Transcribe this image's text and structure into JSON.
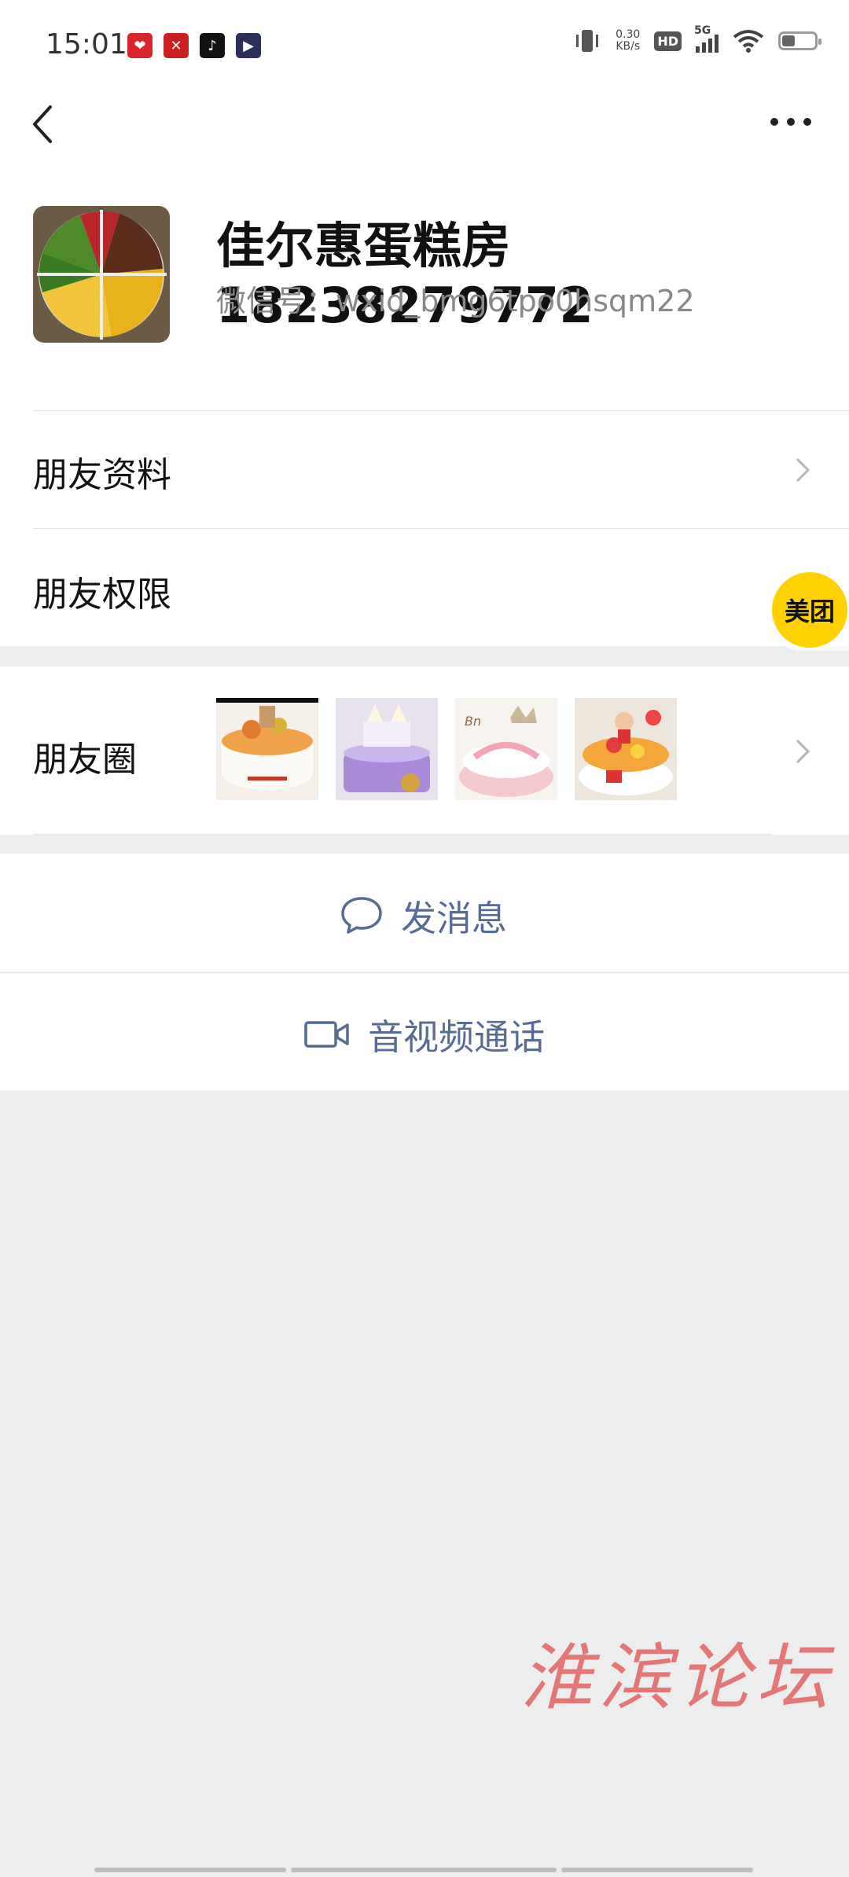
{
  "status_bar": {
    "time": "15:01",
    "net_speed_value": "0.30",
    "net_speed_unit": "KB/s",
    "hd_label": "HD",
    "network_label": "5G",
    "apps": [
      "app-icon-1",
      "app-icon-2",
      "tiktok-icon",
      "app-icon-4"
    ],
    "battery_level": 0.4
  },
  "nav": {
    "back_icon": "chevron-left-icon",
    "more_icon": "more-dots-icon"
  },
  "profile": {
    "name": "佳尔惠蛋糕房18238279772",
    "wechat_id": "微信号：wxid_bmg6tpo0hsqm22"
  },
  "rows": {
    "friend_info": "朋友资料",
    "friend_permissions": "朋友权限",
    "moments": "朋友圈"
  },
  "actions": {
    "send_message": "发消息",
    "av_call": "音视频通话"
  },
  "floating": {
    "meituan": "美团"
  },
  "watermark": "淮滨论坛",
  "colors": {
    "link": "#576b95",
    "background": "#ededed",
    "meituan": "#ffd100",
    "watermark": "#e36b6b"
  }
}
